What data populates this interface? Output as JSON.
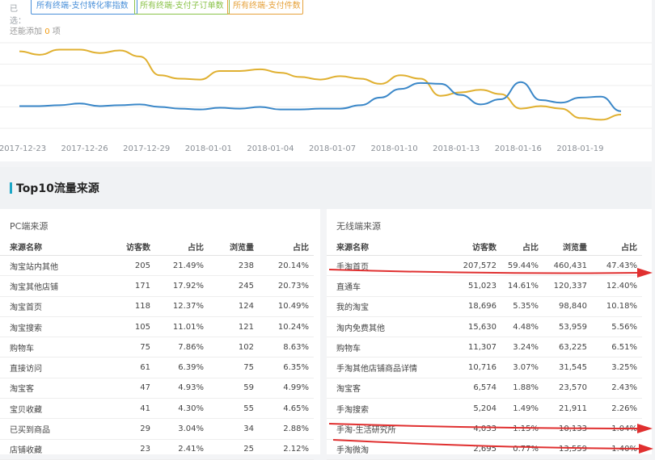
{
  "tags": {
    "prefix": "已选：",
    "items": [
      {
        "label": "所有终端-支付转化率指数",
        "color": "#4a90d9"
      },
      {
        "label": "所有终端-支付子订单数",
        "color": "#8bc34a"
      },
      {
        "label": "所有终端-支付件数",
        "color": "#e6a23c"
      }
    ]
  },
  "hint": {
    "prefix": "还能添加",
    "count": "0",
    "suffix": "项"
  },
  "chart_data": {
    "type": "line",
    "x_labels": [
      "2017-12-23",
      "2017-12-26",
      "2017-12-29",
      "2018-01-01",
      "2018-01-04",
      "2018-01-07",
      "2018-01-10",
      "2018-01-13",
      "2018-01-16",
      "2018-01-19"
    ],
    "y_range": [
      0,
      100
    ],
    "grid": true,
    "series": [
      {
        "color": "#e0b030",
        "values": [
          90,
          86,
          92,
          92,
          88,
          91,
          84,
          62,
          58,
          57,
          67,
          67,
          69,
          65,
          60,
          57,
          61,
          58,
          52,
          62,
          58,
          38,
          42,
          45,
          40,
          23,
          26,
          23,
          12,
          10,
          16
        ]
      },
      {
        "color": "#3a87c8",
        "values": [
          26,
          26,
          27,
          29,
          26,
          27,
          28,
          25,
          23,
          22,
          24,
          23,
          25,
          22,
          22,
          23,
          23,
          27,
          36,
          46,
          53,
          52,
          39,
          28,
          34,
          54,
          33,
          30,
          36,
          37,
          20
        ]
      }
    ]
  },
  "section": {
    "title": "Top10流量来源"
  },
  "pc": {
    "title": "PC端来源",
    "headers": [
      "来源名称",
      "访客数",
      "占比",
      "浏览量",
      "占比"
    ],
    "rows": [
      [
        "淘宝站内其他",
        "205",
        "21.49%",
        "238",
        "20.14%"
      ],
      [
        "淘宝其他店铺",
        "171",
        "17.92%",
        "245",
        "20.73%"
      ],
      [
        "淘宝首页",
        "118",
        "12.37%",
        "124",
        "10.49%"
      ],
      [
        "淘宝搜索",
        "105",
        "11.01%",
        "121",
        "10.24%"
      ],
      [
        "购物车",
        "75",
        "7.86%",
        "102",
        "8.63%"
      ],
      [
        "直接访问",
        "61",
        "6.39%",
        "75",
        "6.35%"
      ],
      [
        "淘宝客",
        "47",
        "4.93%",
        "59",
        "4.99%"
      ],
      [
        "宝贝收藏",
        "41",
        "4.30%",
        "55",
        "4.65%"
      ],
      [
        "已买到商品",
        "29",
        "3.04%",
        "34",
        "2.88%"
      ],
      [
        "店铺收藏",
        "23",
        "2.41%",
        "25",
        "2.12%"
      ]
    ]
  },
  "mobile": {
    "title": "无线端来源",
    "headers": [
      "来源名称",
      "访客数",
      "占比",
      "浏览量",
      "占比"
    ],
    "rows": [
      [
        "手淘首页",
        "207,572",
        "59.44%",
        "460,431",
        "47.43%"
      ],
      [
        "直通车",
        "51,023",
        "14.61%",
        "120,337",
        "12.40%"
      ],
      [
        "我的淘宝",
        "18,696",
        "5.35%",
        "98,840",
        "10.18%"
      ],
      [
        "淘内免费其他",
        "15,630",
        "4.48%",
        "53,959",
        "5.56%"
      ],
      [
        "购物车",
        "11,307",
        "3.24%",
        "63,225",
        "6.51%"
      ],
      [
        "手淘其他店铺商品详情",
        "10,716",
        "3.07%",
        "31,545",
        "3.25%"
      ],
      [
        "淘宝客",
        "6,574",
        "1.88%",
        "23,570",
        "2.43%"
      ],
      [
        "手淘搜索",
        "5,204",
        "1.49%",
        "21,911",
        "2.26%"
      ],
      [
        "手淘-生活研究所",
        "4,033",
        "1.15%",
        "10,133",
        "1.04%"
      ],
      [
        "手淘微淘",
        "2,695",
        "0.77%",
        "13,559",
        "1.40%"
      ]
    ]
  }
}
